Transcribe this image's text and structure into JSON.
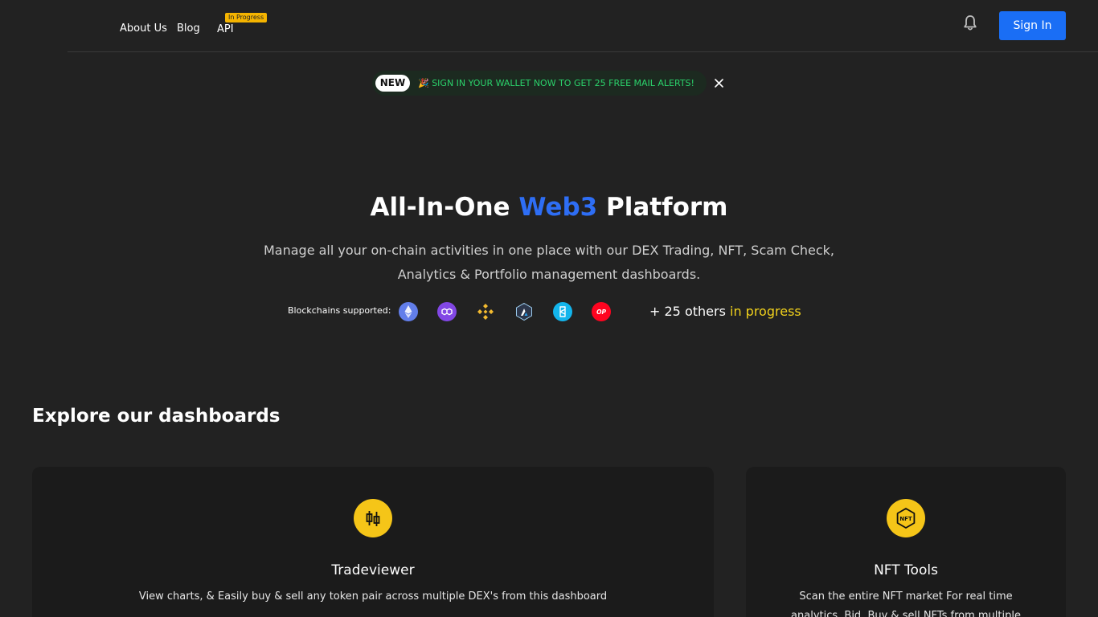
{
  "nav": {
    "items": [
      {
        "label": "About Us"
      },
      {
        "label": "Blog"
      },
      {
        "label": "API",
        "badge": "In Progress"
      }
    ]
  },
  "header": {
    "signin_label": "Sign In",
    "notifications_icon": "bell-icon"
  },
  "announcement": {
    "tag": "NEW",
    "text": "🎉 SIGN IN YOUR WALLET NOW TO GET 25 FREE MAIL ALERTS!",
    "close_icon": "close-icon"
  },
  "hero": {
    "title_prefix": "All-In-One",
    "title_accent": "Web3",
    "title_suffix": "Platform",
    "subtitle": "Manage all your on-chain activities in one place with our DEX Trading, NFT, Scam Check, Analytics & Portfolio management dashboards.",
    "chains_label": "Blockchains supported:",
    "chains": [
      {
        "name": "ethereum",
        "icon": "ethereum-icon",
        "color": "#627eea"
      },
      {
        "name": "polygon",
        "icon": "polygon-icon",
        "color": "#8247e5"
      },
      {
        "name": "bnb",
        "icon": "bnb-icon",
        "color": "#f3ba2f"
      },
      {
        "name": "arbitrum",
        "icon": "arbitrum-icon",
        "color": "#2d374b"
      },
      {
        "name": "fantom",
        "icon": "fantom-icon",
        "color": "#13b5ec"
      },
      {
        "name": "optimism",
        "icon": "optimism-icon",
        "color": "#ff0420"
      }
    ],
    "others_text": "+ 25 others",
    "others_status": "in progress"
  },
  "explore": {
    "title": "Explore our dashboards",
    "cards": [
      {
        "title": "Tradeviewer",
        "description": "View charts, & Easily buy & sell any token pair across multiple DEX's from this dashboard",
        "icon": "candlestick-icon"
      },
      {
        "title": "NFT Tools",
        "description": "Scan the entire NFT market For real time analytics. Bid, Buy & sell NFTs from multiple",
        "icon": "nft-icon"
      }
    ]
  },
  "colors": {
    "background": "#222222",
    "accent_blue": "#2e6ef5",
    "button_blue": "#1a6ef5",
    "highlight_yellow": "#f2d21c",
    "announce_green": "#2bd26b",
    "icon_yellow": "#f5c518"
  }
}
